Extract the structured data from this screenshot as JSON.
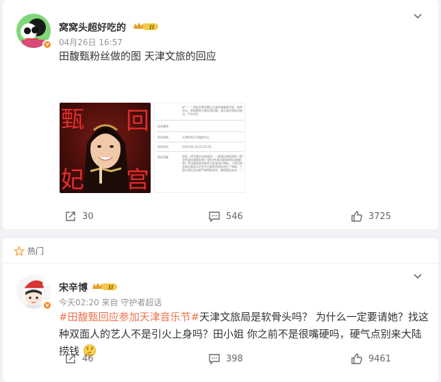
{
  "post1": {
    "user": "窝窝头超好吃的",
    "level": "II",
    "time": "04月26日 16:57",
    "text": "田馥甄粉丝做的图 天津文旅的回应",
    "image1_chars": [
      "甄",
      "回",
      "宫",
      "妃"
    ],
    "doc_text": {
      "top": "好！！！网友反映问题后天津文旅顺差评说，有的评论，等较期系方做实领问题。请天津文旅会对留点，不允许反",
      "label_topic": "投诉事项",
      "label_org": "投诉机构",
      "org": "天津市音乐节服务中心",
      "label_time": "投诉时间",
      "time": "2024-04-24 23:21:05",
      "label_reply": "投诉回复",
      "reply": "您好，经专委文化旅游局：一是演出审批按照《营业性演出管理条例》《营业性演出管理条例实施细则》等法规规定的程序与标准进行审批；二是对演员政治表现与艺术节主题是否相关进行了审核；三是在演出活动前严格审批安排，确保演出安全……"
    },
    "repost_count": "30",
    "comment_count": "546",
    "like_count": "3725"
  },
  "hot_label": "热门",
  "post2": {
    "user": "宋辛博",
    "level": "II",
    "time": "今天02:20 来自 守护者超话",
    "hashtag": "#田馥甄回应参加天津音乐节#",
    "text": "天津文旅局是软骨头吗？ 为什么一定要请她？找这种双面人的艺人不是引火上身吗？田小姐 你之前不是很嘴硬吗，硬气点别来大陆捞钱",
    "repost_count": "46",
    "comment_count": "398",
    "like_count": "9461"
  },
  "colors": {
    "accent": "#eb7350",
    "vbadge": "#f78b2b",
    "bg": "#f1f2f5"
  }
}
